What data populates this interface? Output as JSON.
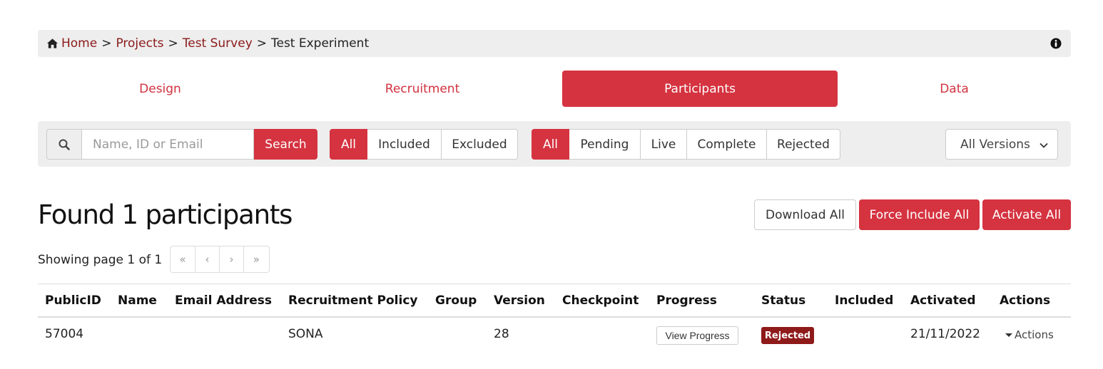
{
  "breadcrumb": {
    "home": "Home",
    "projects": "Projects",
    "survey": "Test Survey",
    "current": "Test Experiment",
    "separator": ">"
  },
  "tabs": [
    {
      "label": "Design"
    },
    {
      "label": "Recruitment"
    },
    {
      "label": "Participants"
    },
    {
      "label": "Data"
    }
  ],
  "search": {
    "placeholder": "Name, ID or Email",
    "button": "Search"
  },
  "inclusion_filter": [
    "All",
    "Included",
    "Excluded"
  ],
  "status_filter": [
    "All",
    "Pending",
    "Live",
    "Complete",
    "Rejected"
  ],
  "versions_select": "All Versions",
  "title": "Found 1 participants",
  "actions": {
    "download_all": "Download All",
    "force_include_all": "Force Include All",
    "activate_all": "Activate All"
  },
  "pagination": {
    "info": "Showing page 1 of 1",
    "first": "«",
    "prev": "‹",
    "next": "›",
    "last": "»"
  },
  "table": {
    "headers": [
      "PublicID",
      "Name",
      "Email Address",
      "Recruitment Policy",
      "Group",
      "Version",
      "Checkpoint",
      "Progress",
      "Status",
      "Included",
      "Activated",
      "Actions"
    ],
    "rows": [
      {
        "public_id": "57004",
        "name": "",
        "email": "",
        "policy": "SONA",
        "group": "",
        "version": "28",
        "checkpoint": "",
        "progress_button": "View Progress",
        "status": "Rejected",
        "included": "",
        "activated": "21/11/2022",
        "actions": "Actions"
      }
    ]
  },
  "colors": {
    "accent": "#d53340",
    "link": "#8b1a1a",
    "badge_rejected": "#8e1a1a",
    "bar_bg": "#eeeeee"
  }
}
